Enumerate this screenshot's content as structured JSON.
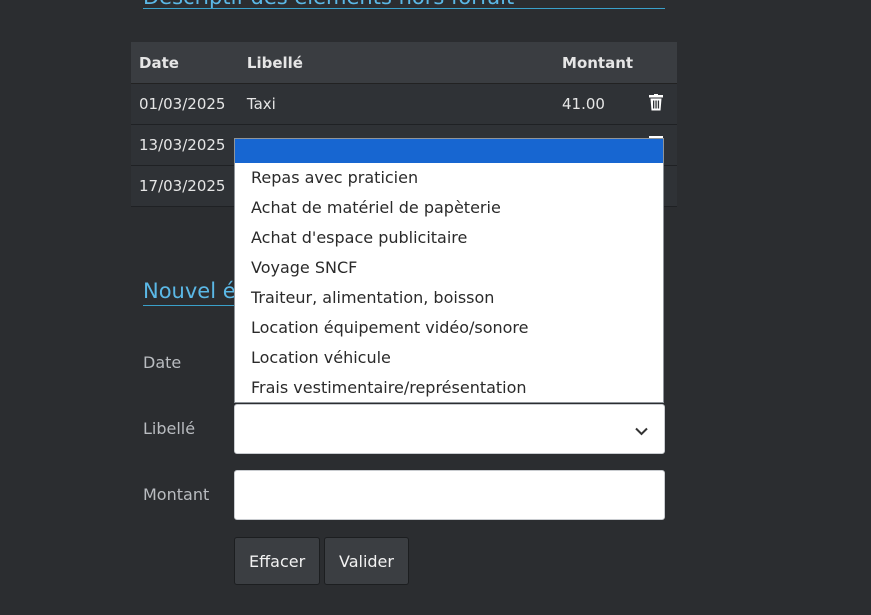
{
  "sections": {
    "top_title": "Descriptif des éléments hors forfait",
    "new_title": "Nouvel élément hors forfait"
  },
  "table": {
    "headers": {
      "date": "Date",
      "label": "Libellé",
      "amount": "Montant"
    },
    "rows": [
      {
        "date": "01/03/2025",
        "label": "Taxi",
        "amount": "41.00"
      },
      {
        "date": "13/03/2025",
        "label": "",
        "amount": ""
      },
      {
        "date": "17/03/2025",
        "label": "",
        "amount": ""
      }
    ]
  },
  "form": {
    "date_label": "Date",
    "label_label": "Libellé",
    "amount_label": "Montant",
    "label_value": "",
    "amount_value": ""
  },
  "dropdown": {
    "options": [
      "Repas avec praticien",
      "Achat de matériel de papèterie",
      "Achat d'espace publicitaire",
      "Voyage SNCF",
      "Traiteur, alimentation, boisson",
      "Location équipement vidéo/sonore",
      "Location véhicule",
      "Frais vestimentaire/représentation"
    ]
  },
  "buttons": {
    "clear": "Effacer",
    "submit": "Valider"
  },
  "colors": {
    "accent": "#5bb8e6",
    "highlight": "#1766d1",
    "background": "#2b2d30"
  },
  "icons": {
    "delete": "trash-icon",
    "dropdown": "chevron-down-icon"
  }
}
